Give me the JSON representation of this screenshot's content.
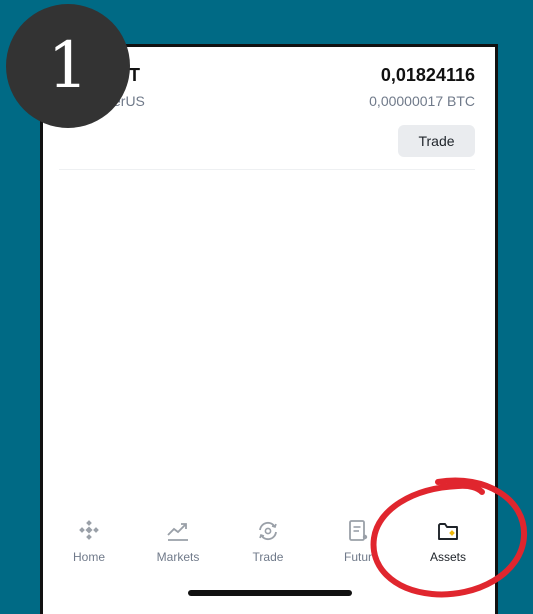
{
  "step": {
    "number": "1"
  },
  "asset": {
    "symbol": "DT",
    "name": "erUS",
    "amount": "0,01824116",
    "btc_value": "0,00000017 BTC",
    "trade_label": "Trade"
  },
  "tabbar": {
    "items": [
      {
        "label": "Home",
        "icon": "binance-logo-icon"
      },
      {
        "label": "Markets",
        "icon": "chart-up-icon"
      },
      {
        "label": "Trade",
        "icon": "trade-swap-icon"
      },
      {
        "label": "Futur",
        "icon": "futures-icon"
      },
      {
        "label": "Assets",
        "icon": "wallet-icon",
        "active": true
      }
    ]
  },
  "colors": {
    "background": "#006a85",
    "highlight": "#e0262e",
    "brand_yellow": "#f0b90b"
  }
}
